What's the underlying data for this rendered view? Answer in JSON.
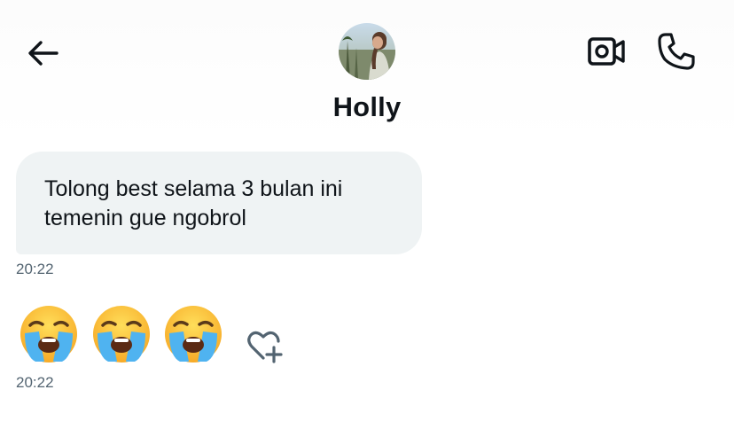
{
  "header": {
    "title": "Holly",
    "back_icon": "arrow-left-icon",
    "video_icon": "video-camera-icon",
    "call_icon": "phone-icon",
    "avatar_alt": "profile photo"
  },
  "messages": [
    {
      "lines": [
        "Tolong best selama 3 bulan ini",
        "temenin gue ngobrol"
      ],
      "time": "20:22"
    },
    {
      "emojis": [
        "😭",
        "😭",
        "😭"
      ],
      "time": "20:22"
    }
  ],
  "reaction": {
    "icon": "heart-plus-icon"
  },
  "colors": {
    "text": "#0f1419",
    "secondary_text": "#536471",
    "bubble_bg": "#eff3f4"
  }
}
